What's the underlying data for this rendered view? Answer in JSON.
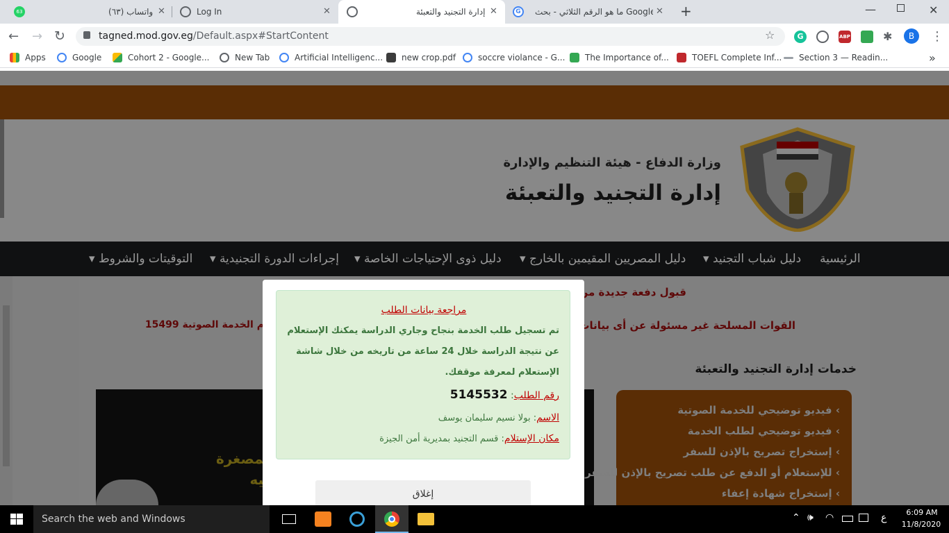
{
  "browser": {
    "tabs": [
      {
        "title": "(٦٣) واتساب",
        "badge": "63"
      },
      {
        "title": "Log In"
      },
      {
        "title": "إدارة التجنيد والتعبئة"
      },
      {
        "title": "ما هو الرقم الثلاثي - بحث Google"
      }
    ],
    "new_tab_symbol": "+",
    "close_symbol": "✕",
    "url_host": "tagned.mod.gov.eg",
    "url_path": "/Default.aspx#StartContent",
    "profile_initial": "B",
    "bookmarks": [
      "Apps",
      "Google",
      "Cohort 2 - Google...",
      "New Tab",
      "Artificial Intelligenc...",
      "new crop.pdf",
      "soccre violance - G...",
      "The Importance of...",
      "TOEFL Complete Inf...",
      "Section 3 — Readin..."
    ],
    "more_bookmarks": "»"
  },
  "site": {
    "subtitle": "وزارة الدفاع - هيئة التنظيم والإدارة",
    "title": "إدارة التجنيد والتعبئة",
    "nav": [
      "الرئيسية",
      "دليل شباب التجنيد",
      "دليل المصريين المقيمين بالخارج",
      "دليل ذوى الإحتياجات الخاصة",
      "إجراءات الدورة التجنيدية",
      "التوقيتات والشروط"
    ],
    "announce1": "قبول دفعة جديدة من",
    "announce2_right": "القوات المسلحة غير مسئولة عن أى بيانات أخرى",
    "announce2_left": "م الخدمة الصوتية 15499",
    "services_title": "خدمات إدارة التجنيد والتعبئة",
    "services": [
      "فيديو توضيحي للخدمة الصوتية",
      "فيديو توضيحي لطلب الخدمة",
      "إستخراج تصريح بالإذن للسفر",
      "للإستعلام أو الدفع عن طلب تصريح بالإذن للسفر",
      "إستخراج شهادة إعفاء"
    ],
    "banner_line1": "اء المصغرة",
    "banner_line2": "كارنيه"
  },
  "modal": {
    "heading": "مراجعة بيانات الطلب",
    "body_lines": [
      "تم تسجيل طلب الخدمة بنجاح وجاري الدراسة يمكنك الإستعلام",
      "عن نتيجة الدراسة خلال 24 ساعة من تاريخه من خلال شاشة",
      "الإستعلام لمعرفة موقفك."
    ],
    "request_label": "رقم الطلب",
    "request_number": "5145532",
    "name_label": "الاسم",
    "name_value": "بولا نسيم سليمان يوسف",
    "place_label": "مكان الإستلام",
    "place_value": "قسم التجنيد بمديرية أمن الجيزة",
    "close_button": "إغلاق"
  },
  "taskbar": {
    "search_placeholder": "Search the web and Windows",
    "time": "6:09 AM",
    "date": "11/8/2020",
    "lang": "ع"
  },
  "colors": {
    "accent_red": "#c00000",
    "success_text": "#3c763d",
    "header_brown": "#5a2d05"
  }
}
